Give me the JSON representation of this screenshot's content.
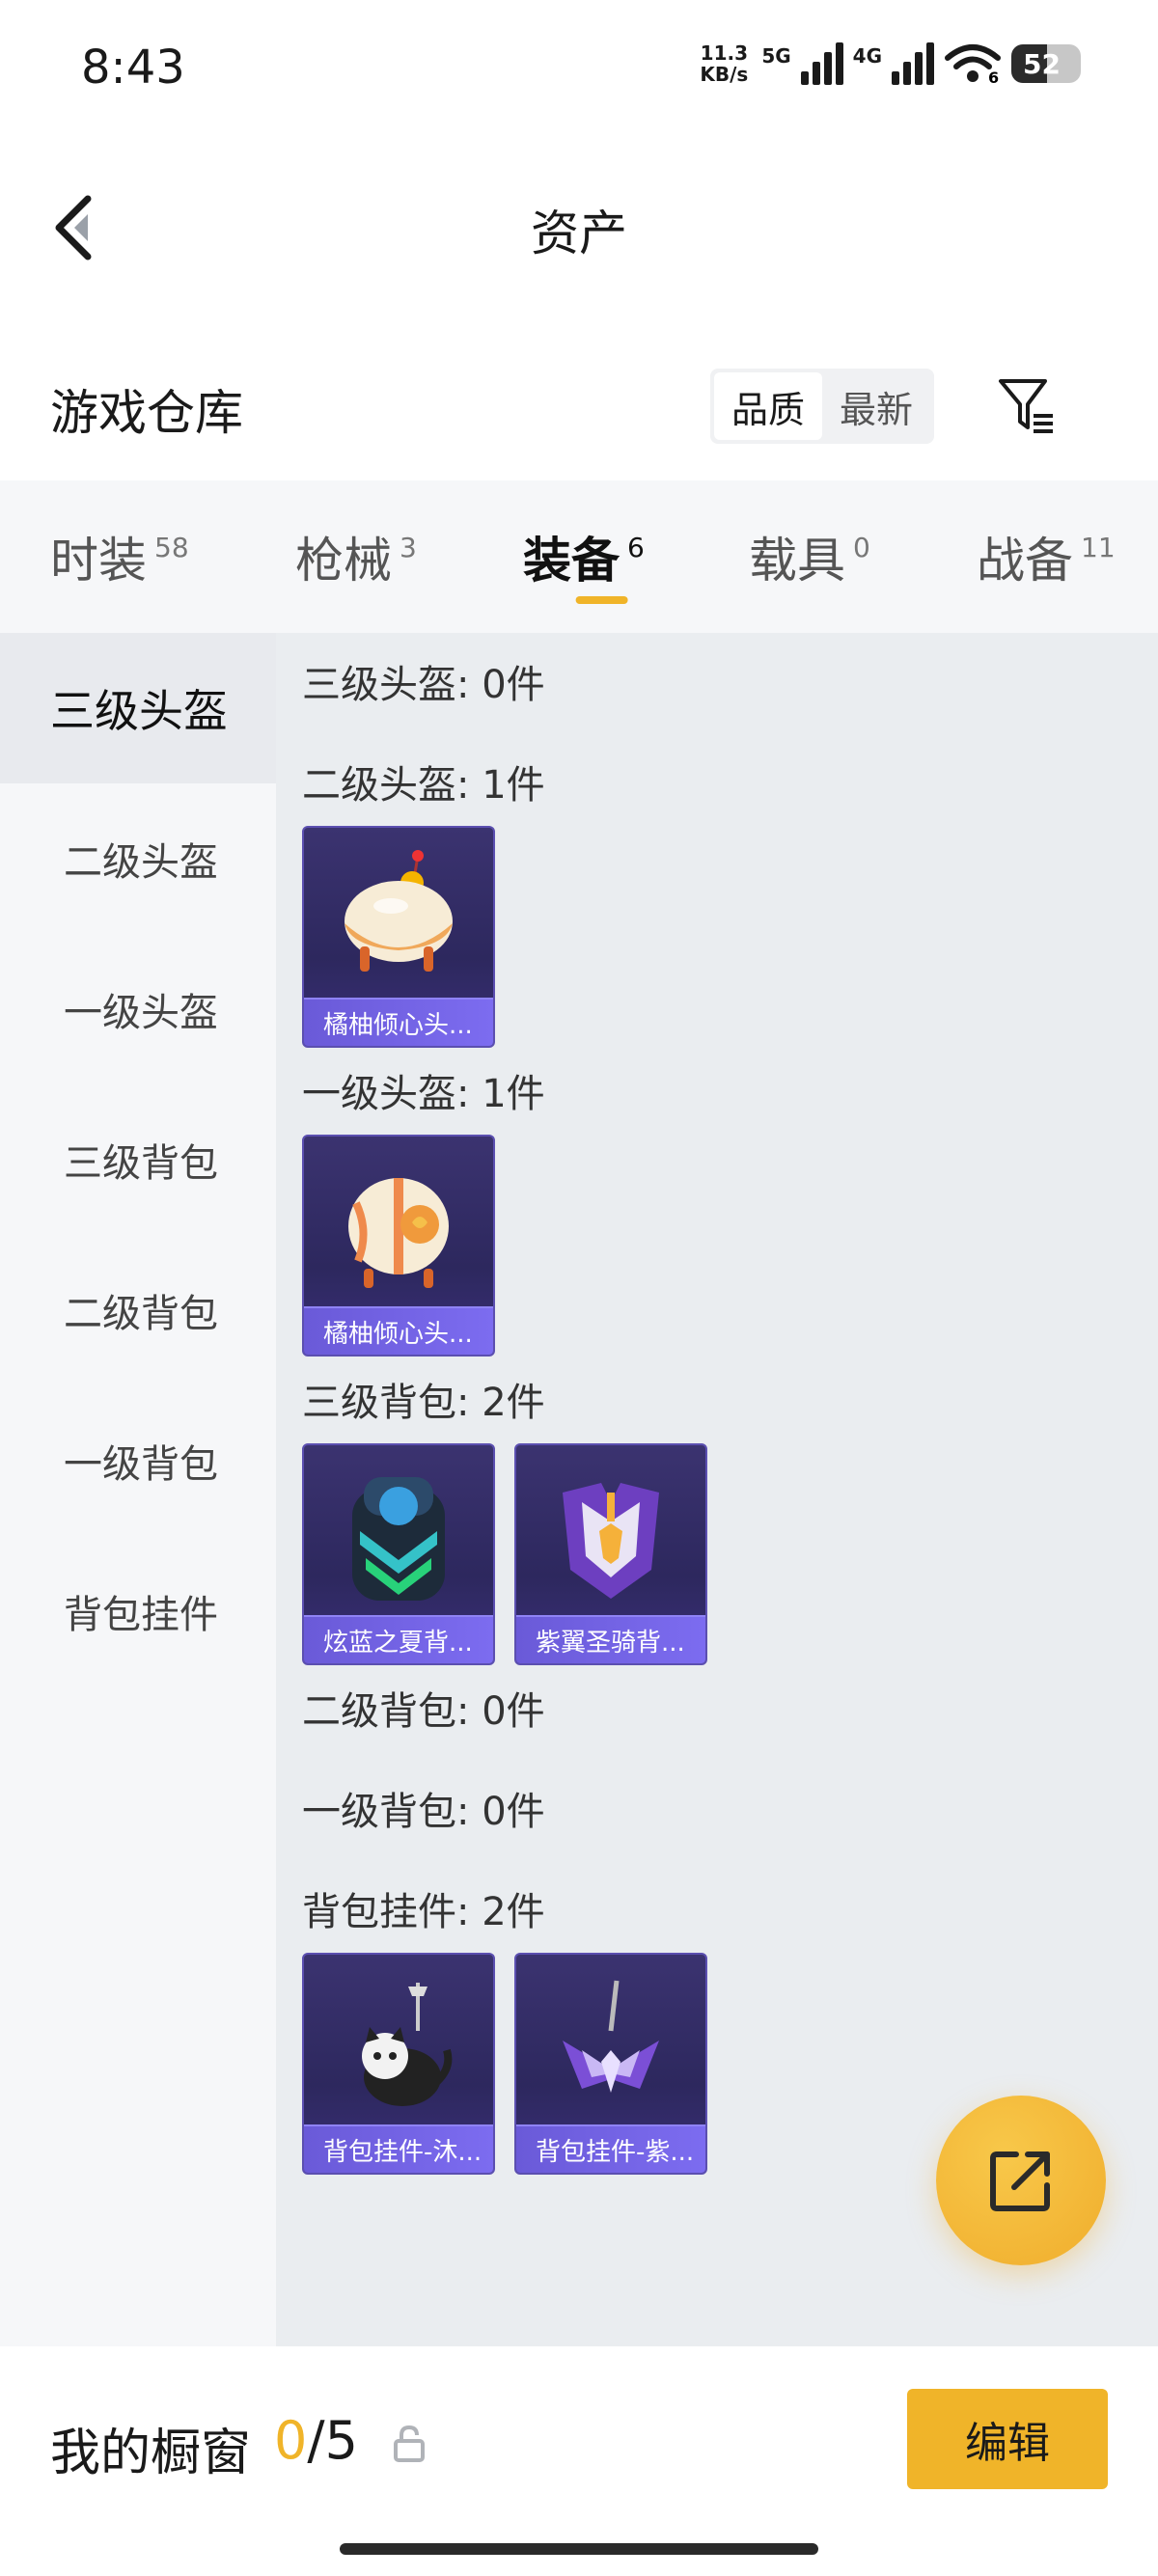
{
  "status_bar": {
    "time": "8:43",
    "net_speed_value": "11.3",
    "net_speed_unit": "KB/s",
    "signal1_label": "5G",
    "signal2_label": "4G",
    "wifi_label": "6",
    "battery": "52",
    "battery_fraction": 0.52
  },
  "header": {
    "title": "资产",
    "back_icon": "chevron-left-icon"
  },
  "warehouse": {
    "title": "游戏仓库",
    "sort_options": [
      "品质",
      "最新"
    ],
    "active_sort": "品质",
    "filter_icon": "filter-icon"
  },
  "tabs": [
    {
      "label": "时装",
      "count": "58"
    },
    {
      "label": "枪械",
      "count": "3"
    },
    {
      "label": "装备",
      "count": "6",
      "active": true
    },
    {
      "label": "载具",
      "count": "0"
    },
    {
      "label": "战备",
      "count": "11"
    }
  ],
  "side_menu": [
    {
      "label": "三级头盔",
      "active": true
    },
    {
      "label": "二级头盔"
    },
    {
      "label": "一级头盔"
    },
    {
      "label": "三级背包"
    },
    {
      "label": "二级背包"
    },
    {
      "label": "一级背包"
    },
    {
      "label": "背包挂件"
    }
  ],
  "sections": [
    {
      "title": "三级头盔: 0件",
      "items": []
    },
    {
      "title": "二级头盔: 1件",
      "items": [
        {
          "name": "橘柚倾心头...",
          "icon": "helmet-icon"
        }
      ]
    },
    {
      "title": "一级头盔: 1件",
      "items": [
        {
          "name": "橘柚倾心头...",
          "icon": "helmet-icon"
        }
      ]
    },
    {
      "title": "三级背包: 2件",
      "items": [
        {
          "name": "炫蓝之夏背...",
          "icon": "backpack-icon"
        },
        {
          "name": "紫翼圣骑背...",
          "icon": "backpack-icon"
        }
      ]
    },
    {
      "title": "二级背包: 0件",
      "items": []
    },
    {
      "title": "一级背包: 0件",
      "items": []
    },
    {
      "title": "背包挂件: 2件",
      "items": [
        {
          "name": "背包挂件-沐...",
          "icon": "cat-charm-icon"
        },
        {
          "name": "背包挂件-紫...",
          "icon": "wing-charm-icon"
        }
      ]
    }
  ],
  "fab": {
    "icon": "share-external-icon"
  },
  "bottom_bar": {
    "label": "我的橱窗",
    "current": "0",
    "separator": "/",
    "max": "5",
    "lock_icon": "lock-icon",
    "edit_label": "编辑"
  },
  "colors": {
    "accent": "#f0b429",
    "card_bg": "#2d285e",
    "card_label": "#7c6cf0"
  }
}
